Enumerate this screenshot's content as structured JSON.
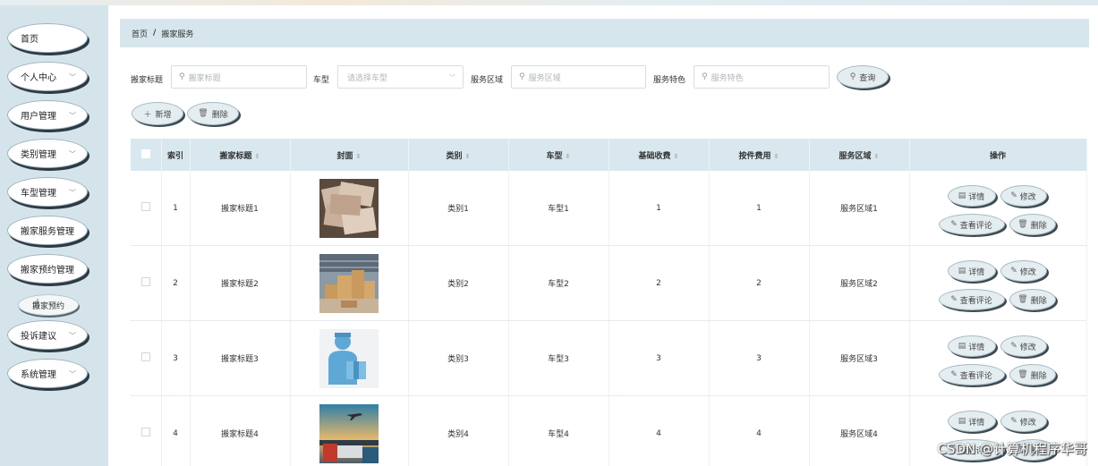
{
  "nav": {
    "items": [
      {
        "label": "首页",
        "chevron": false
      },
      {
        "label": "个人中心",
        "chevron": true
      },
      {
        "label": "用户管理",
        "chevron": true
      },
      {
        "label": "类别管理",
        "chevron": true
      },
      {
        "label": "车型管理",
        "chevron": true
      },
      {
        "label": "搬家服务管理",
        "chevron": false
      },
      {
        "label": "搬家预约管理",
        "chevron": false
      },
      {
        "label": "投诉建议",
        "chevron": true
      },
      {
        "label": "系统管理",
        "chevron": true
      }
    ],
    "sub_item": "搬家预约"
  },
  "breadcrumb": {
    "home": "首页",
    "separator": "/",
    "current": "搬家服务"
  },
  "filters": {
    "title_label": "搬家标题",
    "title_placeholder": "搬家标题",
    "car_label": "车型",
    "car_placeholder": "请选择车型",
    "area_label": "服务区域",
    "area_placeholder": "服务区域",
    "feature_label": "服务特色",
    "feature_placeholder": "服务特色",
    "query_button": "查询"
  },
  "actions": {
    "add": "新增",
    "delete": "删除"
  },
  "table": {
    "headers": {
      "index": "索引",
      "title": "搬家标题",
      "cover": "封面",
      "category": "类别",
      "car": "车型",
      "base_fee": "基础收费",
      "piece_fee": "按件费用",
      "area": "服务区域",
      "ops": "操作"
    },
    "row_actions": {
      "detail": "详情",
      "edit": "修改",
      "comments": "查看评论",
      "delete": "删除"
    },
    "rows": [
      {
        "index": "1",
        "title": "搬家标题1",
        "category": "类别1",
        "car": "车型1",
        "base_fee": "1",
        "piece_fee": "1",
        "area": "服务区域1",
        "cover": "documents"
      },
      {
        "index": "2",
        "title": "搬家标题2",
        "category": "类别2",
        "car": "车型2",
        "base_fee": "2",
        "piece_fee": "2",
        "area": "服务区域2",
        "cover": "warehouse-boxes"
      },
      {
        "index": "3",
        "title": "搬家标题3",
        "category": "类别3",
        "car": "车型3",
        "base_fee": "3",
        "piece_fee": "3",
        "area": "服务区域3",
        "cover": "delivery-man"
      },
      {
        "index": "4",
        "title": "搬家标题4",
        "category": "类别4",
        "car": "车型4",
        "base_fee": "4",
        "piece_fee": "4",
        "area": "服务区域4",
        "cover": "truck-plane"
      }
    ]
  },
  "watermark": "CSDN @计算机程序华哥",
  "colors": {
    "sidebar": "#d5e4ea",
    "header": "#d8e8ee",
    "accent_shadow": "#2c3a44"
  }
}
